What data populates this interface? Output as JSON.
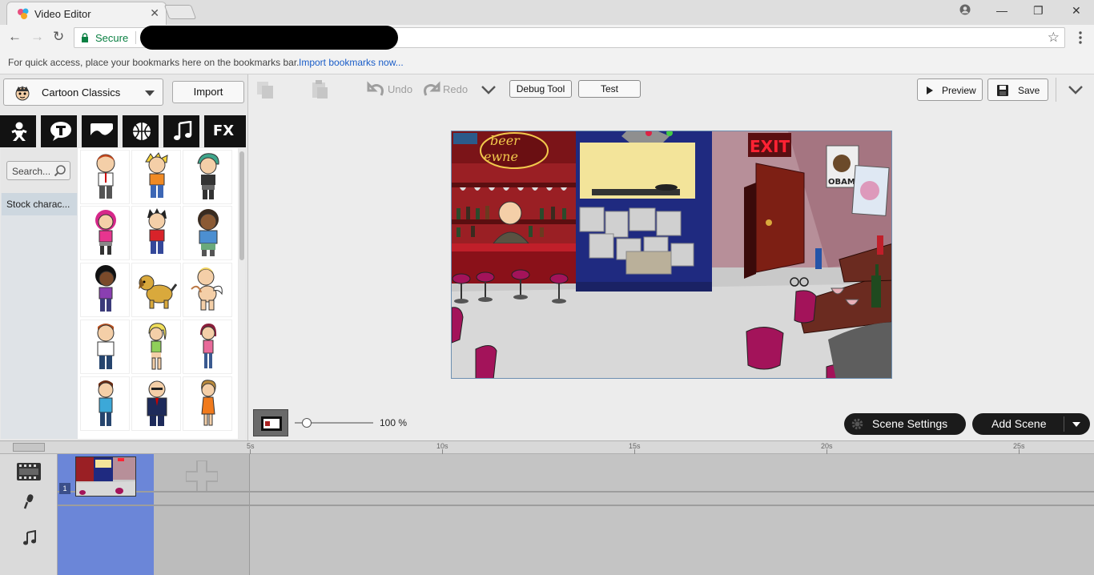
{
  "browser": {
    "tab_title": "Video Editor",
    "secure_label": "Secure",
    "bookmarks_hint": "For quick access, place your bookmarks here on the bookmarks bar.",
    "bookmarks_link": "Import bookmarks now..."
  },
  "left_panel": {
    "collection": "Cartoon Classics",
    "import_label": "Import",
    "categories": [
      "character-icon",
      "text-bubble-icon",
      "background-icon",
      "prop-ball-icon",
      "music-note-icon",
      "FX"
    ],
    "search_placeholder": "Search...",
    "stock_label": "Stock charac..."
  },
  "toolbar": {
    "undo_label": "Undo",
    "redo_label": "Redo",
    "debug_label": "Debug Tool",
    "test_label": "Test",
    "preview_label": "Preview",
    "save_label": "Save"
  },
  "stage": {
    "zoom_label": "100 %",
    "zoom_fraction": 0.15,
    "sign_beer_1": "beer",
    "sign_beer_2": "ewne",
    "exit_sign": "EXIT",
    "poster_text": "OBAMA"
  },
  "scene_controls": {
    "settings_label": "Scene Settings",
    "add_label": "Add Scene"
  },
  "timeline": {
    "ticks": [
      "5s",
      "10s",
      "15s",
      "20s",
      "25s"
    ],
    "scene_number": "1"
  },
  "colors": {
    "accent_blue": "#6b86d8",
    "secure_green": "#0b8043",
    "link_blue": "#1a5dc8",
    "pill_dark": "#1b1b1b"
  }
}
